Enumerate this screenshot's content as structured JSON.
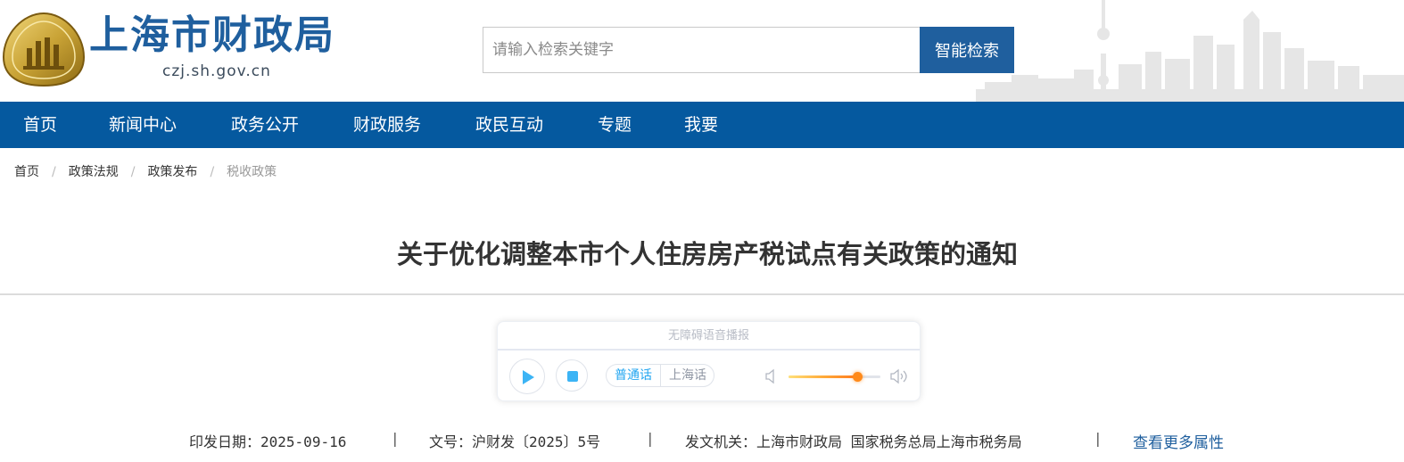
{
  "header": {
    "site_name": "上海市财政局",
    "site_domain": "czj.sh.gov.cn",
    "brand_color": "#1f5f9e"
  },
  "search": {
    "placeholder": "请输入检索关键字",
    "button_label": "智能检索"
  },
  "nav": {
    "items": [
      "首页",
      "新闻中心",
      "政务公开",
      "财政服务",
      "政民互动",
      "专题",
      "我要"
    ],
    "background_color": "#05599f"
  },
  "breadcrumb": {
    "items": [
      "首页",
      "政策法规",
      "政策发布",
      "税收政策"
    ],
    "separator": "/"
  },
  "article": {
    "title": "关于优化调整本市个人住房房产税试点有关政策的通知"
  },
  "audio_player": {
    "heading": "无障碍语音播报",
    "languages": [
      "普通话",
      "上海话"
    ],
    "selected_language": "普通话",
    "volume_fraction": 0.75,
    "icons": [
      "play-icon",
      "stop-icon",
      "volume-low-icon",
      "volume-high-icon"
    ]
  },
  "meta": {
    "date_label": "印发日期：",
    "date_value": "2025-09-16",
    "doc_no_label": "文号：",
    "doc_no_value": "沪财发〔2025〕5号",
    "issuer_label": "发文机关：",
    "issuer_value": "上海市财政局 国家税务总局上海市税务局",
    "separator": "|",
    "more_link": "查看更多属性"
  }
}
